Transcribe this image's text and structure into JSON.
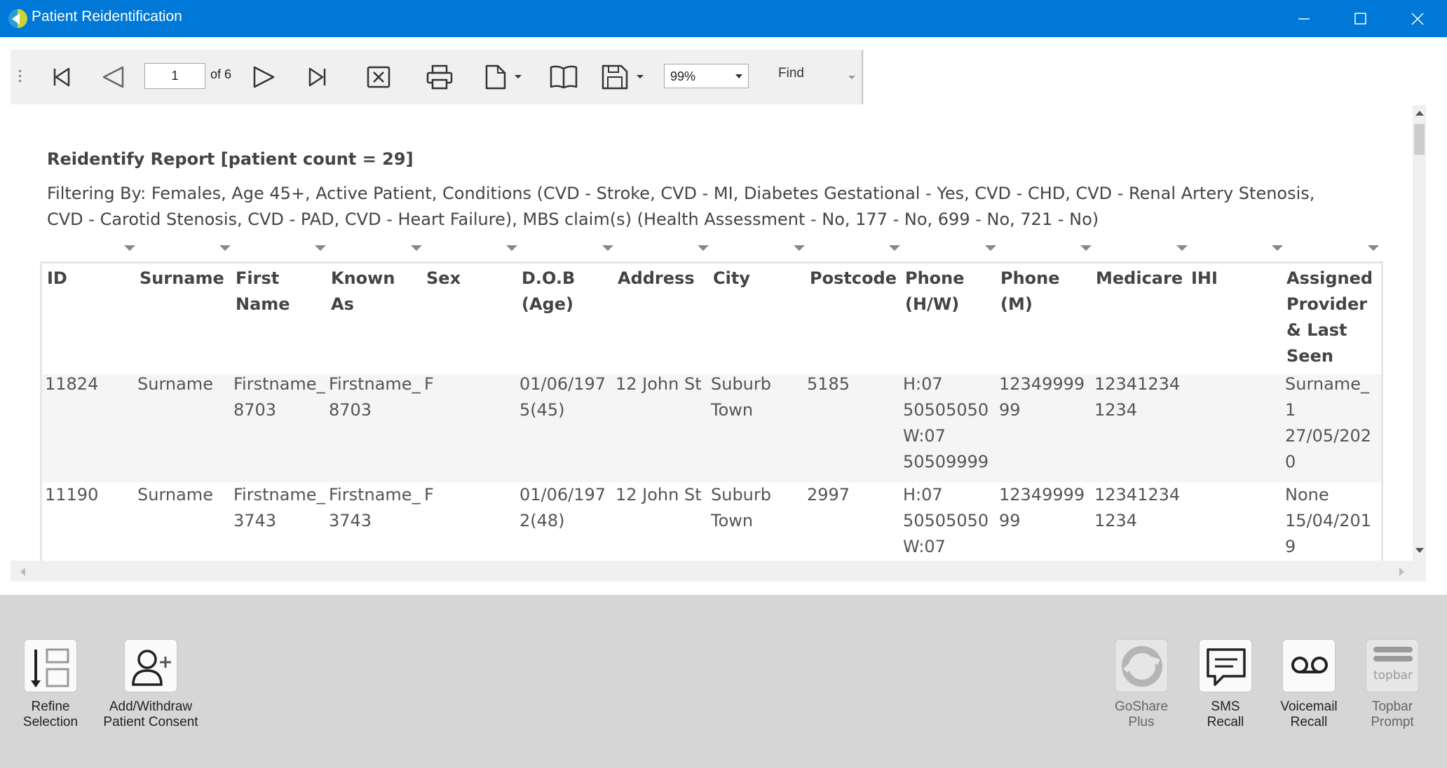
{
  "window": {
    "title": "Patient Reidentification"
  },
  "toolbar": {
    "current_page": "1",
    "page_of": "of 6",
    "zoom": "99%",
    "find_label": "Find"
  },
  "report": {
    "title": "Reidentify Report  [patient count = 29]",
    "filter_line_1": "Filtering By: Females, Age 45+, Active Patient, Conditions (CVD - Stroke, CVD - MI, Diabetes Gestational - Yes, CVD - CHD, CVD - Renal Artery Stenosis,",
    "filter_line_2": "CVD - Carotid Stenosis, CVD - PAD, CVD - Heart Failure), MBS claim(s) (Health Assessment - No, 177 - No, 699 - No, 721 - No)",
    "columns": [
      {
        "lines": [
          "ID"
        ]
      },
      {
        "lines": [
          "Surname"
        ]
      },
      {
        "lines": [
          "First",
          "Name"
        ]
      },
      {
        "lines": [
          "Known",
          "As"
        ]
      },
      {
        "lines": [
          "Sex"
        ]
      },
      {
        "lines": [
          "D.O.B",
          "(Age)"
        ]
      },
      {
        "lines": [
          "Address"
        ]
      },
      {
        "lines": [
          "City"
        ]
      },
      {
        "lines": [
          "Postcode"
        ]
      },
      {
        "lines": [
          "Phone",
          "(H/W)"
        ]
      },
      {
        "lines": [
          "Phone",
          "(M)"
        ]
      },
      {
        "lines": [
          "Medicare"
        ]
      },
      {
        "lines": [
          "IHI"
        ]
      },
      {
        "lines": [
          "Assigned",
          "Provider",
          "& Last",
          "Seen"
        ]
      }
    ],
    "rows": [
      [
        [
          "11824"
        ],
        [
          "Surname"
        ],
        [
          "Firstname_",
          "8703"
        ],
        [
          "Firstname_",
          "8703"
        ],
        [
          "F"
        ],
        [
          "01/06/197",
          "5(45)"
        ],
        [
          "12 John St"
        ],
        [
          "Suburb",
          "Town"
        ],
        [
          "5185"
        ],
        [
          "H:07",
          "50505050",
          "W:07",
          "50509999"
        ],
        [
          "12349999",
          "99"
        ],
        [
          "12341234",
          "1234"
        ],
        [
          ""
        ],
        [
          "Surname_",
          "1",
          "27/05/202",
          "0"
        ]
      ],
      [
        [
          "11190"
        ],
        [
          "Surname"
        ],
        [
          "Firstname_",
          "3743"
        ],
        [
          "Firstname_",
          "3743"
        ],
        [
          "F"
        ],
        [
          "01/06/197",
          "2(48)"
        ],
        [
          "12 John St"
        ],
        [
          "Suburb",
          "Town"
        ],
        [
          "2997"
        ],
        [
          "H:07",
          "50505050",
          "W:07"
        ],
        [
          "12349999",
          "99"
        ],
        [
          "12341234",
          "1234"
        ],
        [
          ""
        ],
        [
          "None",
          "15/04/201",
          "9"
        ]
      ]
    ]
  },
  "actions": {
    "refine": "Refine\nSelection",
    "consent": "Add/Withdraw\nPatient Consent",
    "goshare": "GoShare\nPlus",
    "sms": "SMS\nRecall",
    "voicemail": "Voicemail\nRecall",
    "topbar": "Topbar\nPrompt",
    "topbar_logo_text": "topbar"
  },
  "colors": {
    "titlebar": "#0078d7",
    "panel": "#d6d6d6",
    "row_alt": "#f5f5f5"
  }
}
